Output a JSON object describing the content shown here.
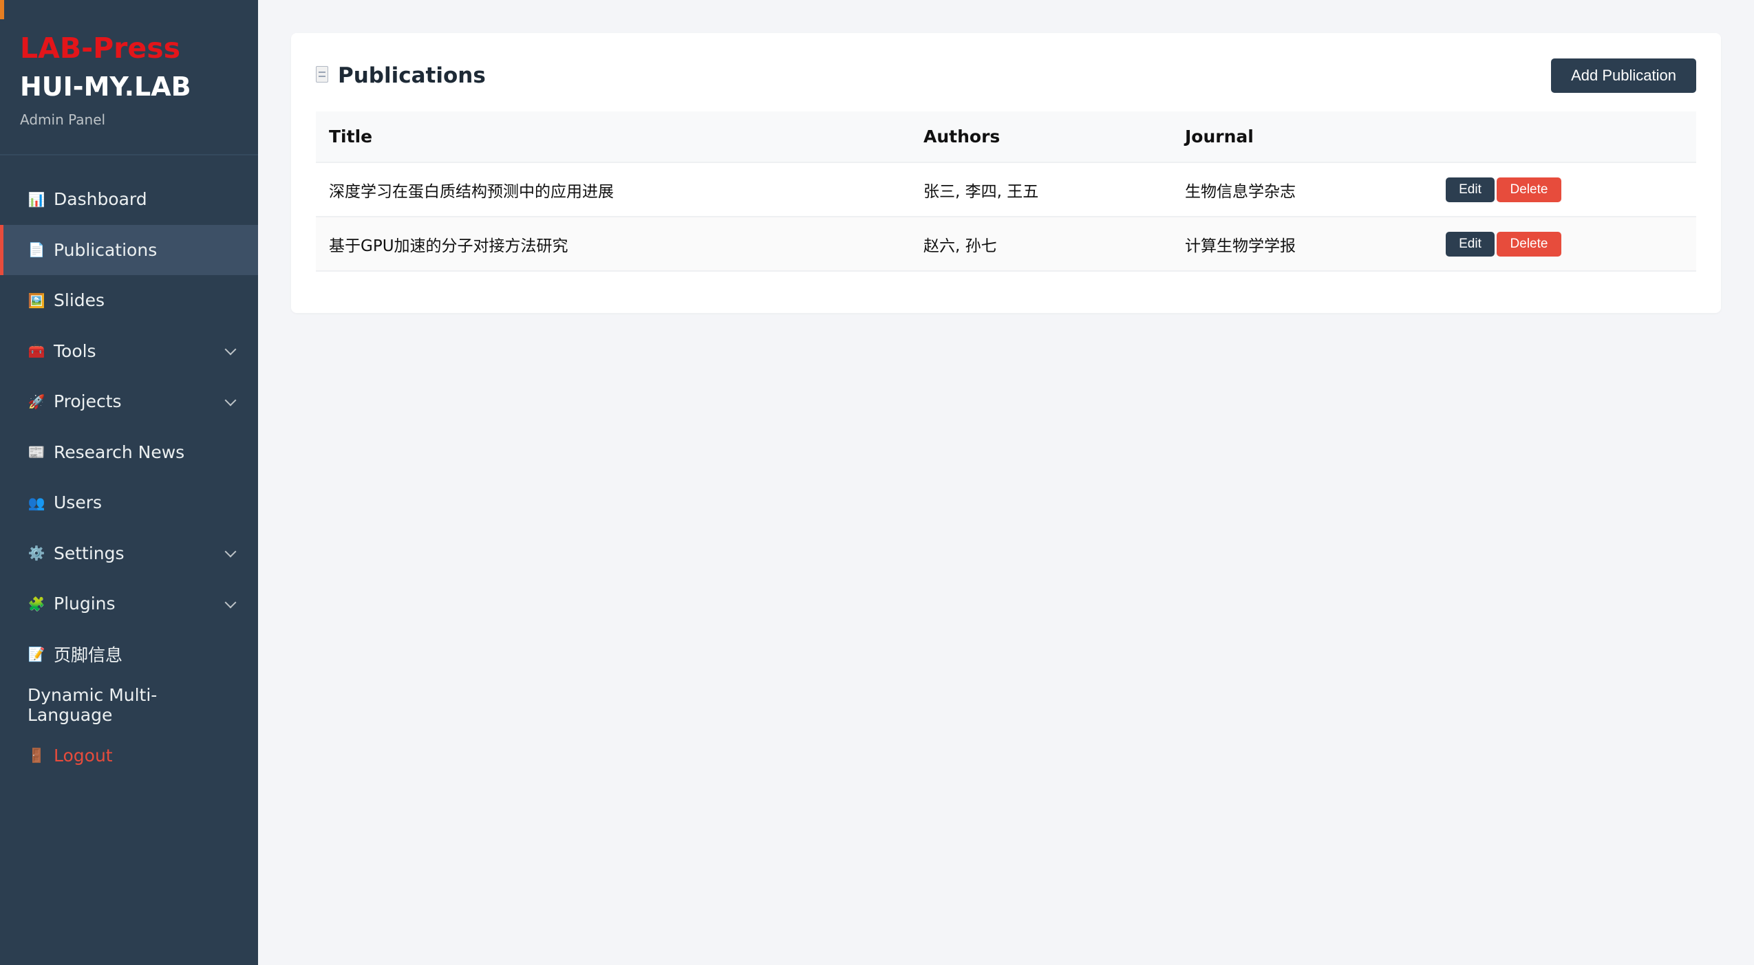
{
  "sidebar": {
    "brand_top": "LAB-Press",
    "brand_main": "HUI-MY.LAB",
    "brand_sub": "Admin Panel",
    "items": [
      {
        "label": "Dashboard",
        "icon": "📊"
      },
      {
        "label": "Publications",
        "icon": "📄"
      },
      {
        "label": "Slides",
        "icon": "🖼️"
      },
      {
        "label": "Tools",
        "icon": "🧰"
      },
      {
        "label": "Projects",
        "icon": "🚀"
      },
      {
        "label": "Research News",
        "icon": "📰"
      },
      {
        "label": "Users",
        "icon": "👥"
      },
      {
        "label": "Settings",
        "icon": "⚙️"
      },
      {
        "label": "Plugins",
        "icon": "🧩"
      },
      {
        "label": "页脚信息",
        "icon": "📝"
      },
      {
        "label": "Dynamic Multi-Language"
      },
      {
        "label": "Logout",
        "icon": "🚪"
      }
    ]
  },
  "main": {
    "title": "Publications",
    "add_button": "Add Publication",
    "columns": [
      "Title",
      "Authors",
      "Journal"
    ],
    "rows": [
      {
        "title": "深度学习在蛋白质结构预测中的应用进展",
        "authors": "张三, 李四, 王五",
        "journal": "生物信息学杂志"
      },
      {
        "title": "基于GPU加速的分子对接方法研究",
        "authors": "赵六, 孙七",
        "journal": "计算生物学学报"
      }
    ],
    "edit_label": "Edit",
    "delete_label": "Delete"
  },
  "colors": {
    "sidebar_bg": "#2c3e50",
    "accent_red": "#e74c3c",
    "brand_red": "#e3151a",
    "page_bg": "#f4f5f8"
  }
}
